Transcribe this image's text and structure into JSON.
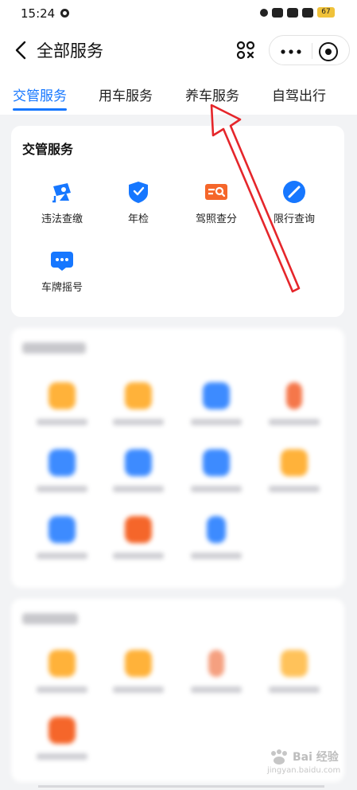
{
  "status_bar": {
    "time": "15:24",
    "battery": "67"
  },
  "nav": {
    "title": "全部服务"
  },
  "tabs": [
    {
      "label": "交管服务",
      "active": true
    },
    {
      "label": "用车服务",
      "active": false
    },
    {
      "label": "养车服务",
      "active": false
    },
    {
      "label": "自驾出行",
      "active": false
    }
  ],
  "traffic_card": {
    "title": "交管服务",
    "items": [
      {
        "label": "违法查缴",
        "icon": "camera-icon"
      },
      {
        "label": "年检",
        "icon": "shield-icon"
      },
      {
        "label": "驾照查分",
        "icon": "license-search-icon"
      },
      {
        "label": "限行查询",
        "icon": "no-entry-icon"
      },
      {
        "label": "车牌摇号",
        "icon": "message-icon"
      }
    ]
  },
  "colors": {
    "accent": "#1677ff",
    "orange": "#f5662a",
    "arrow": "#e5262b"
  },
  "watermark": {
    "brand": "Bai 经验",
    "url": "jingyan.baidu.com"
  }
}
